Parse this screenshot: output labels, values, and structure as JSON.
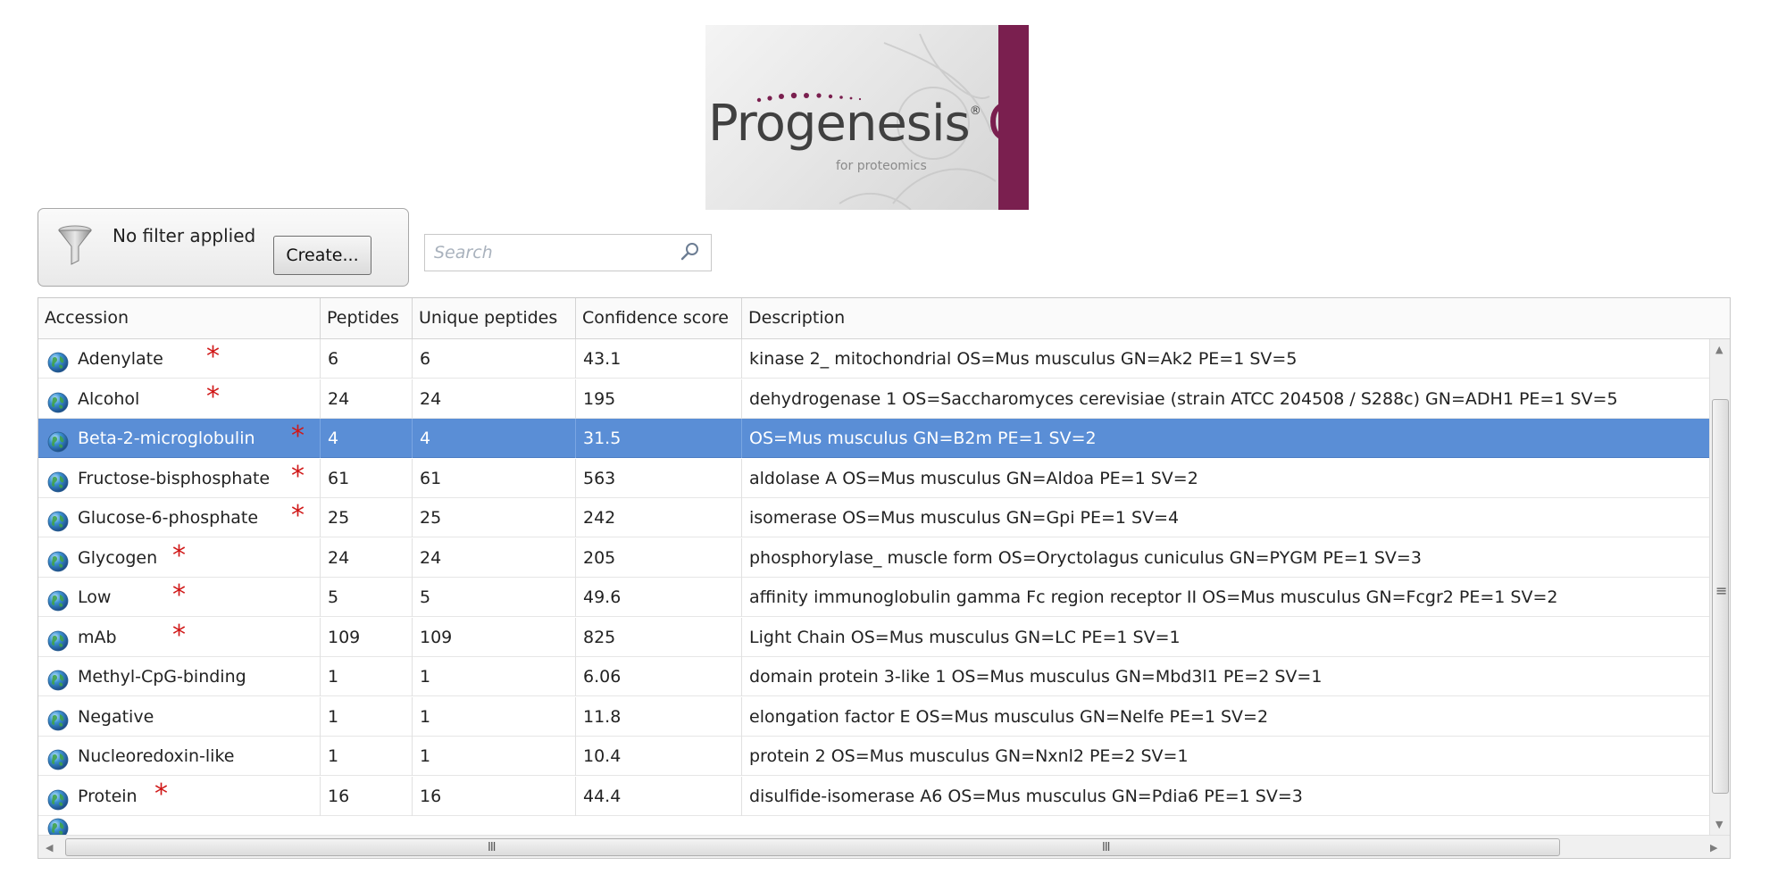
{
  "logo": {
    "wordmark": "Progenesis",
    "registered": "®",
    "qi": "QI",
    "subtitle": "for proteomics",
    "accent_color": "#7a1f4f"
  },
  "filter": {
    "status_text": "No filter applied",
    "create_label": "Create...",
    "icon": "funnel-icon"
  },
  "search": {
    "placeholder": "Search",
    "value": "",
    "icon": "search-icon"
  },
  "table": {
    "columns": [
      "Accession",
      "Peptides",
      "Unique peptides",
      "Confidence score",
      "Description"
    ],
    "selected_color": "#5a8ed6",
    "rows": [
      {
        "accession": "Adenylate",
        "starred": true,
        "peptides": "6",
        "unique": "6",
        "confidence": "43.1",
        "description": "kinase 2_ mitochondrial OS=Mus musculus GN=Ak2 PE=1 SV=5",
        "selected": false
      },
      {
        "accession": "Alcohol",
        "starred": true,
        "peptides": "24",
        "unique": "24",
        "confidence": "195",
        "description": "dehydrogenase 1 OS=Saccharomyces cerevisiae (strain ATCC 204508 / S288c) GN=ADH1 PE=1 SV=5",
        "selected": false
      },
      {
        "accession": "Beta-2-microglobulin",
        "starred": true,
        "peptides": "4",
        "unique": "4",
        "confidence": "31.5",
        "description": "OS=Mus musculus GN=B2m PE=1 SV=2",
        "selected": true
      },
      {
        "accession": "Fructose-bisphosphate",
        "starred": true,
        "peptides": "61",
        "unique": "61",
        "confidence": "563",
        "description": "aldolase A OS=Mus musculus GN=Aldoa PE=1 SV=2",
        "selected": false
      },
      {
        "accession": "Glucose-6-phosphate",
        "starred": true,
        "peptides": "25",
        "unique": "25",
        "confidence": "242",
        "description": "isomerase OS=Mus musculus GN=Gpi PE=1 SV=4",
        "selected": false
      },
      {
        "accession": "Glycogen",
        "starred": true,
        "peptides": "24",
        "unique": "24",
        "confidence": "205",
        "description": "phosphorylase_ muscle form OS=Oryctolagus cuniculus GN=PYGM PE=1 SV=3",
        "selected": false
      },
      {
        "accession": "Low",
        "starred": true,
        "peptides": "5",
        "unique": "5",
        "confidence": "49.6",
        "description": "affinity immunoglobulin gamma Fc region receptor II OS=Mus musculus GN=Fcgr2 PE=1 SV=2",
        "selected": false
      },
      {
        "accession": "mAb",
        "starred": true,
        "peptides": "109",
        "unique": "109",
        "confidence": "825",
        "description": "Light Chain OS=Mus musculus GN=LC PE=1 SV=1",
        "selected": false
      },
      {
        "accession": "Methyl-CpG-binding",
        "starred": false,
        "peptides": "1",
        "unique": "1",
        "confidence": "6.06",
        "description": "domain protein 3-like 1 OS=Mus musculus GN=Mbd3l1 PE=2 SV=1",
        "selected": false
      },
      {
        "accession": "Negative",
        "starred": false,
        "peptides": "1",
        "unique": "1",
        "confidence": "11.8",
        "description": "elongation factor E OS=Mus musculus GN=Nelfe PE=1 SV=2",
        "selected": false
      },
      {
        "accession": "Nucleoredoxin-like",
        "starred": false,
        "peptides": "1",
        "unique": "1",
        "confidence": "10.4",
        "description": "protein 2 OS=Mus musculus GN=Nxnl2 PE=2 SV=1",
        "selected": false
      },
      {
        "accession": "Protein",
        "starred": true,
        "peptides": "16",
        "unique": "16",
        "confidence": "44.4",
        "description": "disulfide-isomerase A6 OS=Mus musculus GN=Pdia6 PE=1 SV=3",
        "selected": false
      }
    ]
  },
  "star_glyph": "*",
  "star_color": "#d01818",
  "scroll": {
    "grip": "III",
    "vgrip": "≡"
  }
}
